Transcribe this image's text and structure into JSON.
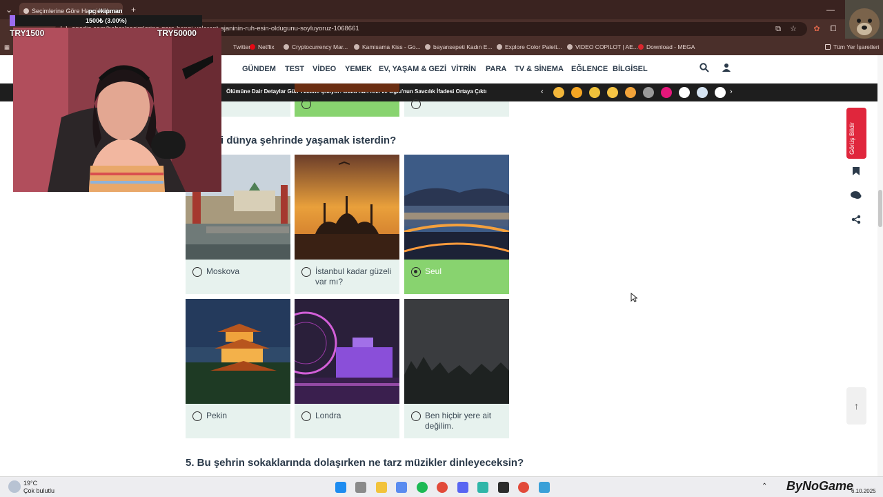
{
  "browser": {
    "tab_title": "Seçimlerine Göre Hangi Valorant Ajanı...",
    "url": "onedio.com/haber/secimlerine-gore-hangi-valorant-ajaninin-ruh-esin-oldugunu-soyluyoruz-1068661",
    "bookmarks": [
      "Twitter",
      "Netflix",
      "Cryptocurrency Mar...",
      "Kamisama Kiss - Go...",
      "bayansepeti Kadın E...",
      "Explore Color Palett...",
      "VIDEO COPILOT | AE...",
      "Download - MEGA"
    ],
    "all_bookmarks": "Tüm Yer İşaretleri"
  },
  "stream_overlay": {
    "goal_label": "pc ekipman",
    "goal_progress": "1500₺ (3.00%)",
    "goal_current": "TRY1500",
    "goal_target": "TRY50000",
    "progress_fraction": 0.03
  },
  "site": {
    "nav": [
      "GÜNDEM",
      "TEST",
      "VİDEO",
      "YEMEK",
      "EV, YAŞAM & GEZİ",
      "VİTRİN",
      "PARA",
      "TV & SİNEMA",
      "EĞLENCE",
      "BİLGİSEL"
    ],
    "ticker": "Ölümüne Dair Detaylar Gün Yüzüne Çıkıyor: Güllü'nün Kızı ve Oğlu'nun Savcılık İfadesi Ortaya Çıktı",
    "feedback": "Görüş Bildir"
  },
  "quiz": {
    "question_4": "i dünya şehrinde yaşamak isterdin?",
    "question_5": "5. Bu şehrin sokaklarında dolaşırken ne tarz müzikler dinleyeceksin?",
    "options": [
      {
        "label": "Moskova",
        "selected": false
      },
      {
        "label": "İstanbul kadar güzeli var mı?",
        "selected": false
      },
      {
        "label": "Seul",
        "selected": true
      },
      {
        "label": "Pekin",
        "selected": false
      },
      {
        "label": "Londra",
        "selected": false
      },
      {
        "label": "Ben hiçbir yere ait değilim.",
        "selected": false
      }
    ]
  },
  "taskbar": {
    "temperature": "19°C",
    "weather": "Çok bulutlu",
    "date": "6.10.2025",
    "watermark": "ByNoGame"
  },
  "colors": {
    "selected_green": "#88d36f",
    "card_bg": "#e7f2ee",
    "feedback_red": "#e0263c",
    "chrome_brown": "#3a2320"
  }
}
